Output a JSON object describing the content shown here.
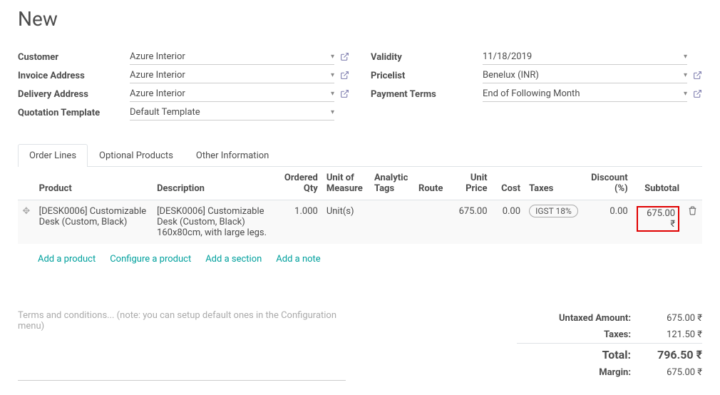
{
  "header": {
    "title": "New"
  },
  "left_fields": {
    "customer": {
      "label": "Customer",
      "value": "Azure Interior"
    },
    "invoice_address": {
      "label": "Invoice Address",
      "value": "Azure Interior"
    },
    "delivery_address": {
      "label": "Delivery Address",
      "value": "Azure Interior"
    },
    "quotation_template": {
      "label": "Quotation Template",
      "value": "Default Template"
    }
  },
  "right_fields": {
    "validity": {
      "label": "Validity",
      "value": "11/18/2019"
    },
    "pricelist": {
      "label": "Pricelist",
      "value": "Benelux (INR)"
    },
    "payment_terms": {
      "label": "Payment Terms",
      "value": "End of Following Month"
    }
  },
  "tabs": {
    "order_lines": "Order Lines",
    "optional_products": "Optional Products",
    "other_information": "Other Information"
  },
  "columns": {
    "product": "Product",
    "description": "Description",
    "ordered_qty_l1": "Ordered",
    "ordered_qty_l2": "Qty",
    "uom_l1": "Unit of",
    "uom_l2": "Measure",
    "analytic_l1": "Analytic",
    "analytic_l2": "Tags",
    "route": "Route",
    "unit_price_l1": "Unit",
    "unit_price_l2": "Price",
    "cost": "Cost",
    "taxes": "Taxes",
    "discount_l1": "Discount",
    "discount_l2": "(%)",
    "subtotal": "Subtotal"
  },
  "line": {
    "product": "[DESK0006] Customizable Desk (Custom, Black)",
    "description": "[DESK0006] Customizable Desk (Custom, Black) 160x80cm, with large legs.",
    "qty": "1.000",
    "uom": "Unit(s)",
    "analytic": "",
    "route": "",
    "unit_price": "675.00",
    "cost": "0.00",
    "taxes": "IGST 18%",
    "discount": "0.00",
    "subtotal": "675.00 ₹"
  },
  "line_actions": {
    "add_product": "Add a product",
    "configure_product": "Configure a product",
    "add_section": "Add a section",
    "add_note": "Add a note"
  },
  "terms_placeholder": "Terms and conditions... (note: you can setup default ones in the Configuration menu)",
  "totals": {
    "untaxed_label": "Untaxed Amount:",
    "untaxed_value": "675.00 ₹",
    "taxes_label": "Taxes:",
    "taxes_value": "121.50 ₹",
    "total_label": "Total:",
    "total_value": "796.50 ₹",
    "margin_label": "Margin:",
    "margin_value": "675.00 ₹"
  }
}
